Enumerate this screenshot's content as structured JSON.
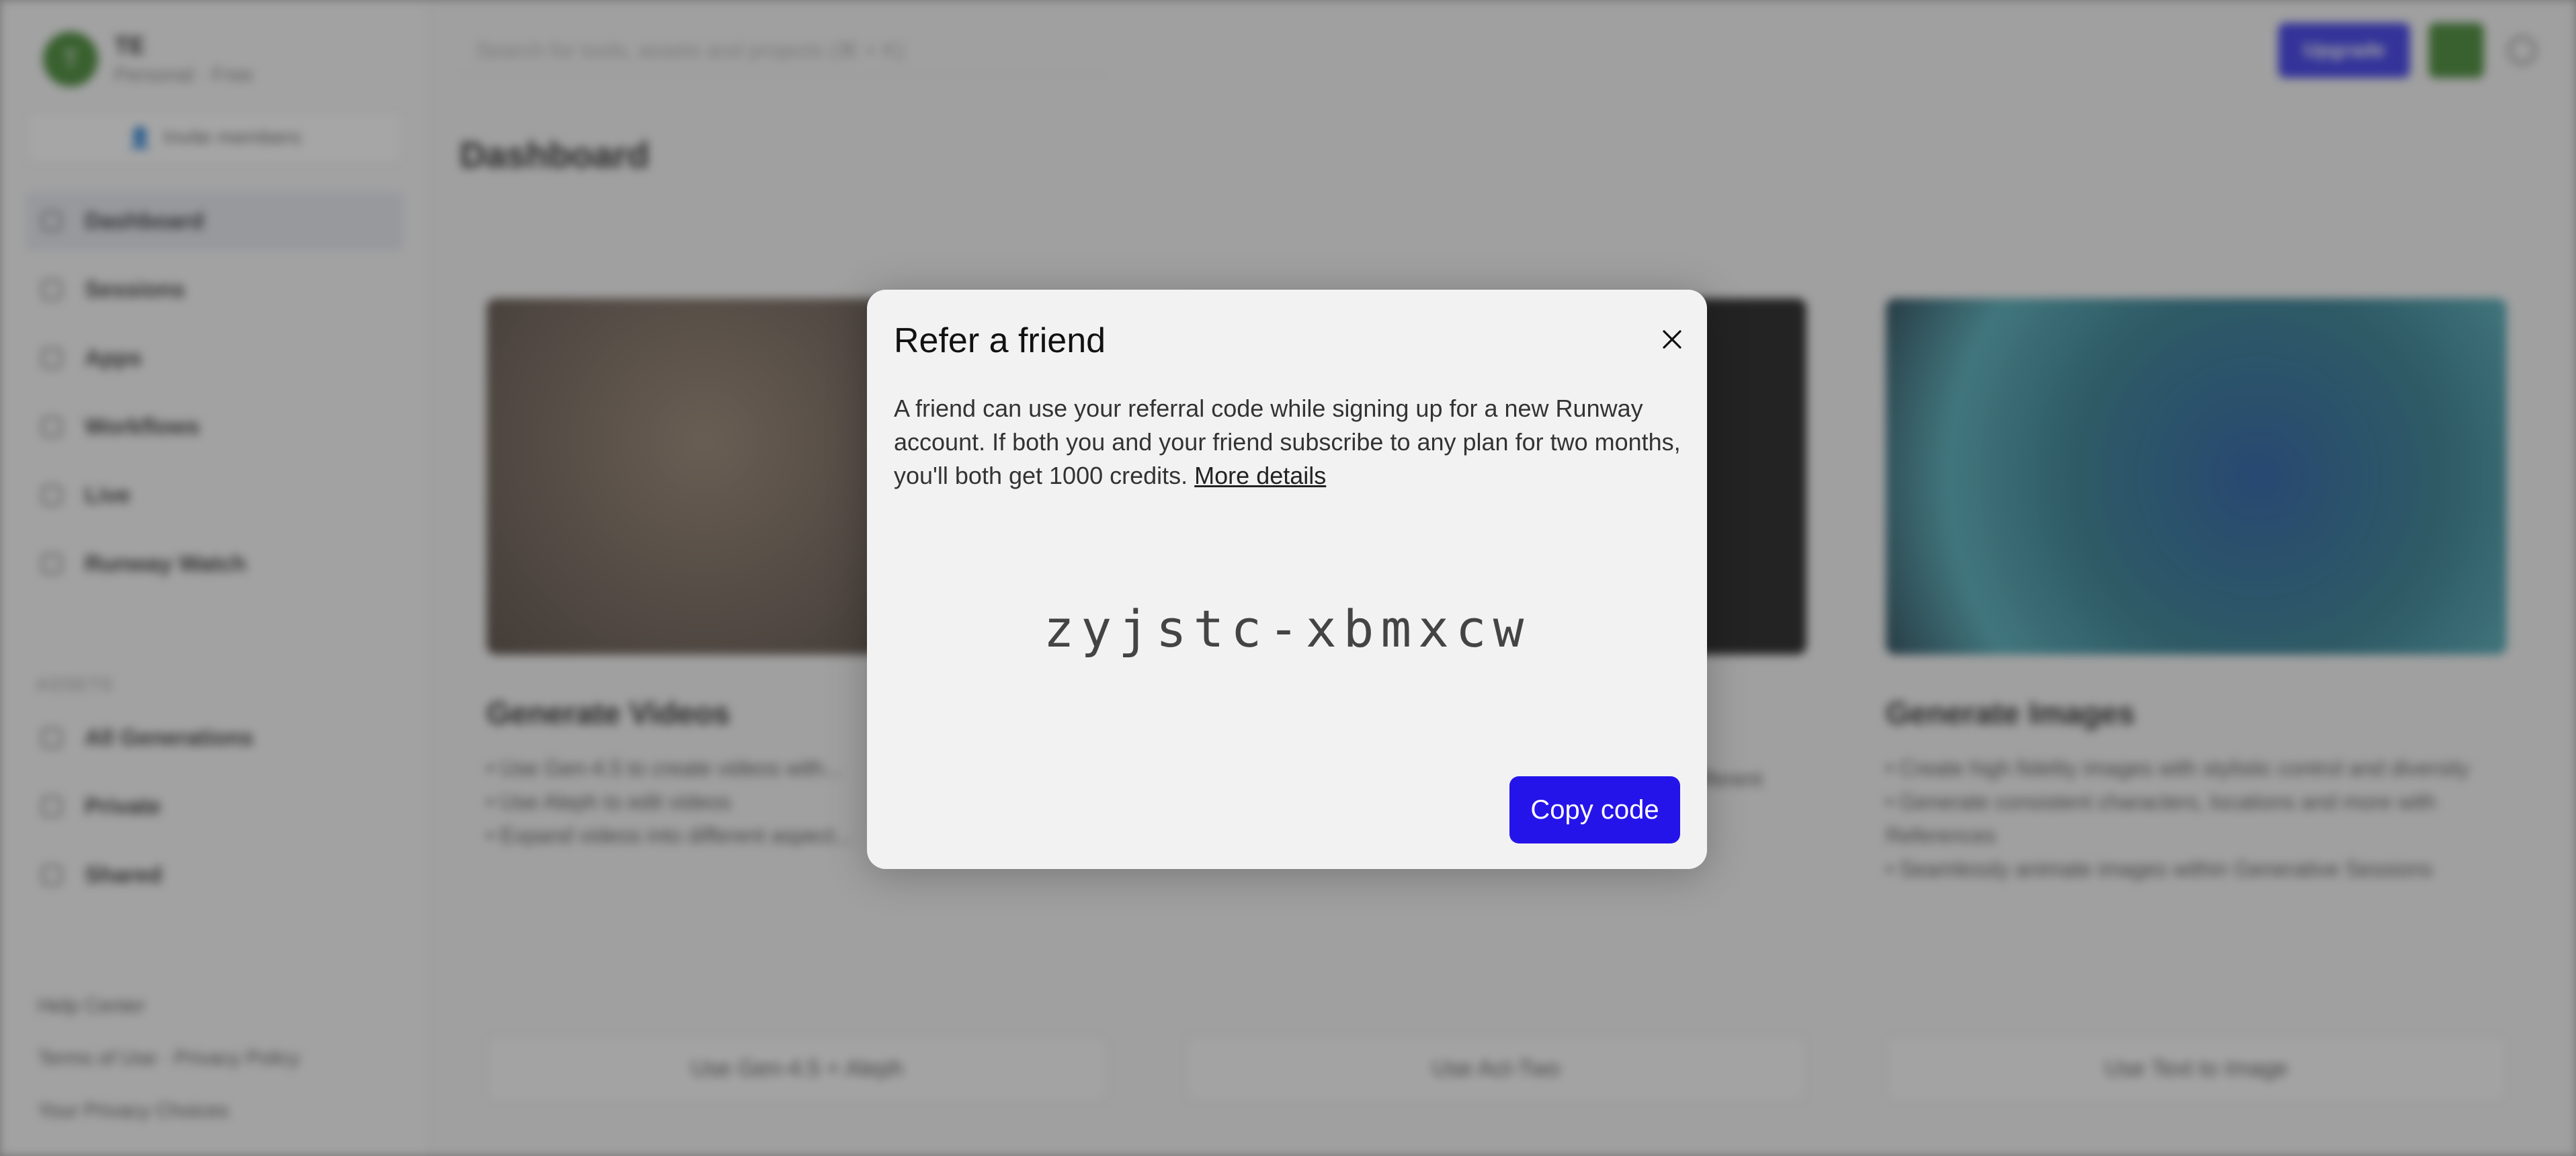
{
  "sidebar": {
    "team_initial": "T",
    "team_name": "TE",
    "team_plan": "Personal · Free",
    "invite_label": "Invite members",
    "nav_items": [
      {
        "label": "Dashboard"
      },
      {
        "label": "Sessions"
      },
      {
        "label": "Apps"
      },
      {
        "label": "Workflows"
      },
      {
        "label": "Live"
      },
      {
        "label": "Runway Watch"
      }
    ],
    "assets_label": "ASSETS",
    "asset_items": [
      {
        "label": "All Generations"
      },
      {
        "label": "Private"
      },
      {
        "label": "Shared"
      }
    ],
    "help_center": "Help Center",
    "terms": "Terms of Use · Privacy Policy",
    "privacy_choices": "Your Privacy Choices"
  },
  "topbar": {
    "search_placeholder": "Search for tools, assets and projects (⌘ + K)",
    "upgrade_label": "Upgrade"
  },
  "main": {
    "page_title": "Dashboard",
    "cards": [
      {
        "title": "Generate Videos",
        "bullets": [
          "• Use Gen-4.5 to create videos with...",
          "• Use Aleph to edit videos",
          "• Expand videos into different aspect..."
        ],
        "button": "Use Gen-4.5 + Aleph"
      },
      {
        "title": "",
        "bullets": [
          "...",
          "...",
          "• Works across live action and animated characters, different camera angles and ranges of expression"
        ],
        "button": "Use Act-Two"
      },
      {
        "title": "Generate Images",
        "bullets": [
          "• Create high fidelity images with stylistic control and diversity",
          "• Generate consistent characters, locations and more with References",
          "• Seamlessly animate images within Generative Sessions"
        ],
        "button": "Use Text to Image"
      }
    ]
  },
  "modal": {
    "title": "Refer a friend",
    "close_icon": "close-icon",
    "body": "A friend can use your referral code while signing up for a new Runway account. If both you and your friend subscribe to any plan for two months, you'll both get 1000 credits.",
    "more_details": "More details",
    "referral_code": "zyjstc-xbmxcw",
    "copy_label": "Copy code"
  },
  "colors": {
    "accent": "#2514ea",
    "avatar": "#2f7a1c",
    "overlay": "rgba(70,70,70,0.48)"
  }
}
